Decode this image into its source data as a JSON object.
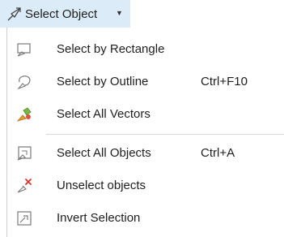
{
  "toolbar": {
    "select_object_label": "Select Object",
    "select_object_icon": "pointer-arrow-icon",
    "caret_icon": "chevron-down-icon"
  },
  "menu": {
    "items": [
      {
        "label": "Select by Rectangle",
        "shortcut": "",
        "icon": "select-rectangle-icon"
      },
      {
        "label": "Select by Outline",
        "shortcut": "Ctrl+F10",
        "icon": "select-outline-icon"
      },
      {
        "label": "Select All Vectors",
        "shortcut": "",
        "icon": "select-all-vectors-icon"
      },
      {
        "label": "Select All Objects",
        "shortcut": "Ctrl+A",
        "icon": "select-all-objects-icon"
      },
      {
        "label": "Unselect objects",
        "shortcut": "",
        "icon": "unselect-icon"
      },
      {
        "label": "Invert Selection",
        "shortcut": "",
        "icon": "invert-selection-icon"
      }
    ]
  },
  "colors": {
    "button_highlight": "#dcebf8",
    "icon_gray": "#7a7a7a",
    "accent_red": "#e0302a",
    "accent_green": "#7ab648",
    "accent_orange": "#e99a2c"
  }
}
